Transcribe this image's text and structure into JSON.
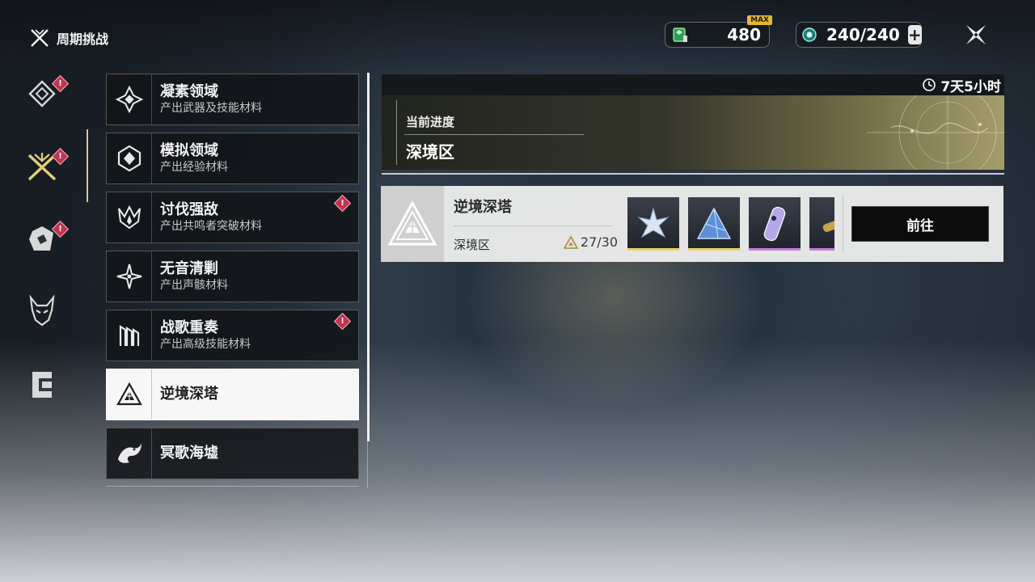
{
  "header": {
    "title": "周期挑战"
  },
  "currencies": [
    {
      "icon": "stamina-crystal-icon",
      "value": "480",
      "badge": "MAX"
    },
    {
      "icon": "energy-orb-icon",
      "value": "240/240"
    }
  ],
  "rail": {
    "items": [
      {
        "icon": "diamond-crest-icon",
        "alert": "!"
      },
      {
        "icon": "crossed-swords-icon",
        "alert": "!",
        "active": true
      },
      {
        "icon": "shield-emblem-icon",
        "alert": "!"
      },
      {
        "icon": "demon-mask-icon"
      },
      {
        "icon": "bracket-gate-icon"
      }
    ]
  },
  "categories": [
    {
      "name": "凝素领域",
      "sub": "产出武器及技能材料",
      "icon": "ornate-cross-icon"
    },
    {
      "name": "模拟领域",
      "sub": "产出经验材料",
      "icon": "hex-diamond-icon"
    },
    {
      "name": "讨伐强敌",
      "sub": "产出共鸣者突破材料",
      "icon": "horned-flame-icon",
      "alert": "!"
    },
    {
      "name": "无音清剿",
      "sub": "产出声骸材料",
      "icon": "sparkle-star-icon"
    },
    {
      "name": "战歌重奏",
      "sub": "产出高级技能材料",
      "icon": "rune-glyph-icon",
      "alert": "!"
    },
    {
      "name": "逆境深塔",
      "icon": "triangle-tower-icon",
      "active": true
    },
    {
      "name": "冥歌海墟",
      "icon": "sea-serpent-icon"
    }
  ],
  "detail": {
    "timer": "7天5小时",
    "progress_label": "当前进度",
    "progress_value": "深境区",
    "tower": {
      "name": "逆境深塔",
      "zone": "深境区",
      "stars": "27/30",
      "rewards": [
        {
          "icon": "star-crystal-icon",
          "rarity_color": "#e8d36a"
        },
        {
          "icon": "blue-shard-icon",
          "rarity_color": "#e8d36a"
        },
        {
          "icon": "capsule-device-icon",
          "rarity_color": "#c77de0"
        },
        {
          "icon": "gold-rod-icon",
          "rarity_color": "#c77de0"
        }
      ],
      "go_label": "前往"
    }
  }
}
